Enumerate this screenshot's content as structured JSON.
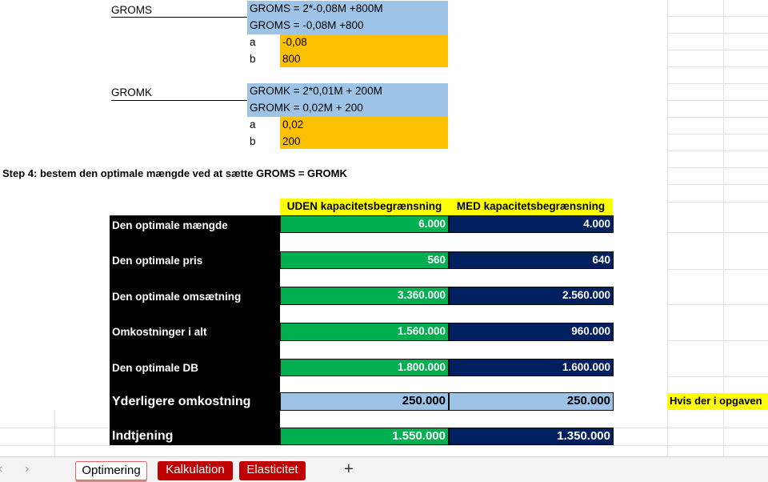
{
  "groms": {
    "label": "GROMS",
    "eq1": "GROMS = 2*-0,08M +800M",
    "eq2": "GROMS = -0,08M +800",
    "a_label": "a",
    "a_value": "-0,08",
    "b_label": "b",
    "b_value": "800"
  },
  "gromk": {
    "label": "GROMK",
    "eq1": "GROMK = 2*0,01M + 200M",
    "eq2": "GROMK = 0,02M + 200",
    "a_label": "a",
    "a_value": "0,02",
    "b_label": "b",
    "b_value": "200"
  },
  "step4": "Step 4: bestem den optimale mængde ved at sætte GROMS = GROMK",
  "table": {
    "col_uden": "UDEN kapacitetsbegrænsning",
    "col_med": "MED kapacitetsbegrænsning",
    "rows": [
      {
        "label": "Den optimale mængde",
        "uden": "6.000",
        "med": "4.000"
      },
      {
        "label": "Den optimale pris",
        "uden": "560",
        "med": "640"
      },
      {
        "label": "Den optimale omsætning",
        "uden": "3.360.000",
        "med": "2.560.000"
      },
      {
        "label": "Omkostninger i alt",
        "uden": "1.560.000",
        "med": "960.000"
      },
      {
        "label": "Den optimale DB",
        "uden": "1.800.000",
        "med": "1.600.000"
      },
      {
        "label": "Yderligere omkostning",
        "uden": "250.000",
        "med": "250.000"
      },
      {
        "label": "Indtjening",
        "uden": "1.550.000",
        "med": "1.350.000"
      }
    ]
  },
  "note": "Hvis der i opgaven",
  "tabs": {
    "prev": "‹",
    "next": "›",
    "items": [
      "Optimering",
      "Kalkulation",
      "Elasticitet"
    ],
    "add": "+"
  }
}
